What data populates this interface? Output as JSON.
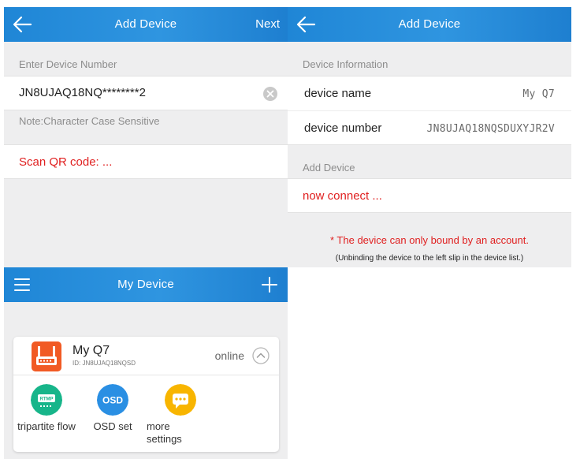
{
  "add_device_input": {
    "title": "Add Device",
    "next_label": "Next",
    "section_label": "Enter Device Number",
    "device_number_value": "JN8UJAQ18NQ********2",
    "note": "Note:Character Case Sensitive",
    "scan_text": "Scan QR code: ..."
  },
  "add_device_connect": {
    "title": "Add Device",
    "info_label": "Device Information",
    "device_name_label": "device name",
    "device_name_value": "My Q7",
    "device_number_label": "device number",
    "device_number_value": "JN8UJAQ18NQSDUXYJR2V",
    "add_label": "Add Device",
    "connect_text": "now connect ...",
    "warning": "* The device can only bound by an account.",
    "hint": "(Unbinding the device to the left slip in the device list.)"
  },
  "my_device": {
    "title": "My Device",
    "device": {
      "name": "My Q7",
      "id": "ID: JN8UJAQ18NQSD",
      "status": "online"
    },
    "actions": [
      {
        "label": "tripartite flow",
        "icon": "rtmp-icon",
        "icon_text": "RTMP",
        "color": "#17b58a"
      },
      {
        "label": "OSD set",
        "icon": "osd-icon",
        "icon_text": "OSD",
        "color": "#2a8fe3"
      },
      {
        "label": "more settings",
        "icon": "more-settings-icon",
        "icon_text": "",
        "color": "#f8b500"
      }
    ]
  },
  "colors": {
    "appbar": "#2f95e0",
    "accent_red": "#e02020",
    "background": "#eeeeef"
  }
}
